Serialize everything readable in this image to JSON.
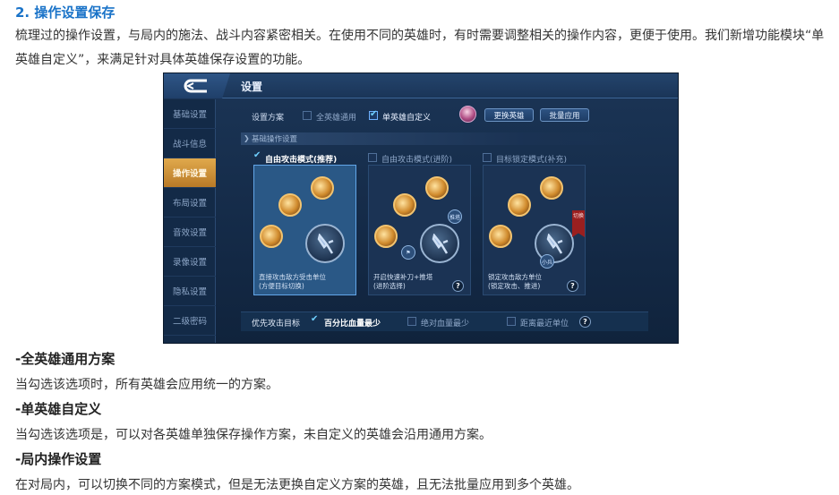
{
  "article": {
    "heading": "2. 操作设置保存",
    "intro": "梳理过的操作设置，与局内的施法、战斗内容紧密相关。在使用不同的英雄时，有时需要调整相关的操作内容，更便于使用。我们新增功能模块“单英雄自定义”，来满足针对具体英雄保存设置的功能。",
    "sections": [
      {
        "title": "-全英雄通用方案",
        "text": "当勾选该选项时，所有英雄会应用统一的方案。"
      },
      {
        "title": "-单英雄自定义",
        "text": "当勾选该选项是，可以对各英雄单独保存操作方案，未自定义的英雄会沿用通用方案。"
      },
      {
        "title": "-局内操作设置",
        "text": "在对局内，可以切换不同的方案模式，但是无法更换自定义方案的英雄，且无法批量应用到多个英雄。"
      }
    ]
  },
  "game": {
    "title": "设置",
    "sidebar": [
      "基础设置",
      "战斗信息",
      "操作设置",
      "布局设置",
      "音效设置",
      "录像设置",
      "隐私设置",
      "二级密码"
    ],
    "active_sidebar": "操作设置",
    "plan": {
      "label": "设置方案",
      "options": [
        {
          "label": "全英雄通用",
          "checked": false
        },
        {
          "label": "单英雄自定义",
          "checked": true
        }
      ],
      "change_hero": "更换英雄",
      "batch_apply": "批量应用"
    },
    "section_title": "基础操作设置",
    "modes": [
      {
        "title": "自由攻击模式(推荐)",
        "checked": true,
        "desc1": "直接攻击敌方受击单位",
        "desc2": "(方便目标切换)"
      },
      {
        "title": "自由攻击模式(进阶)",
        "checked": false,
        "desc1": "开启快速补刀+推塔",
        "desc2": "(进阶选择)"
      },
      {
        "title": "目标锁定模式(补充)",
        "checked": false,
        "desc1": "锁定攻击敌方单位",
        "desc2": "(锁定攻击、推进)"
      }
    ],
    "mini_icons": {
      "tower": "推塔",
      "minion": "小兵"
    },
    "red_tag": "切换",
    "priority": {
      "label": "优先攻击目标",
      "options": [
        {
          "label": "百分比血量最少",
          "checked": true
        },
        {
          "label": "绝对血量最少",
          "checked": false
        },
        {
          "label": "距离最近单位",
          "checked": false
        }
      ]
    },
    "help_glyph": "?",
    "colors": {
      "accent_blue": "#6fd0ff",
      "active_tab": "#d99a3f",
      "panel": "#1b3556"
    }
  }
}
